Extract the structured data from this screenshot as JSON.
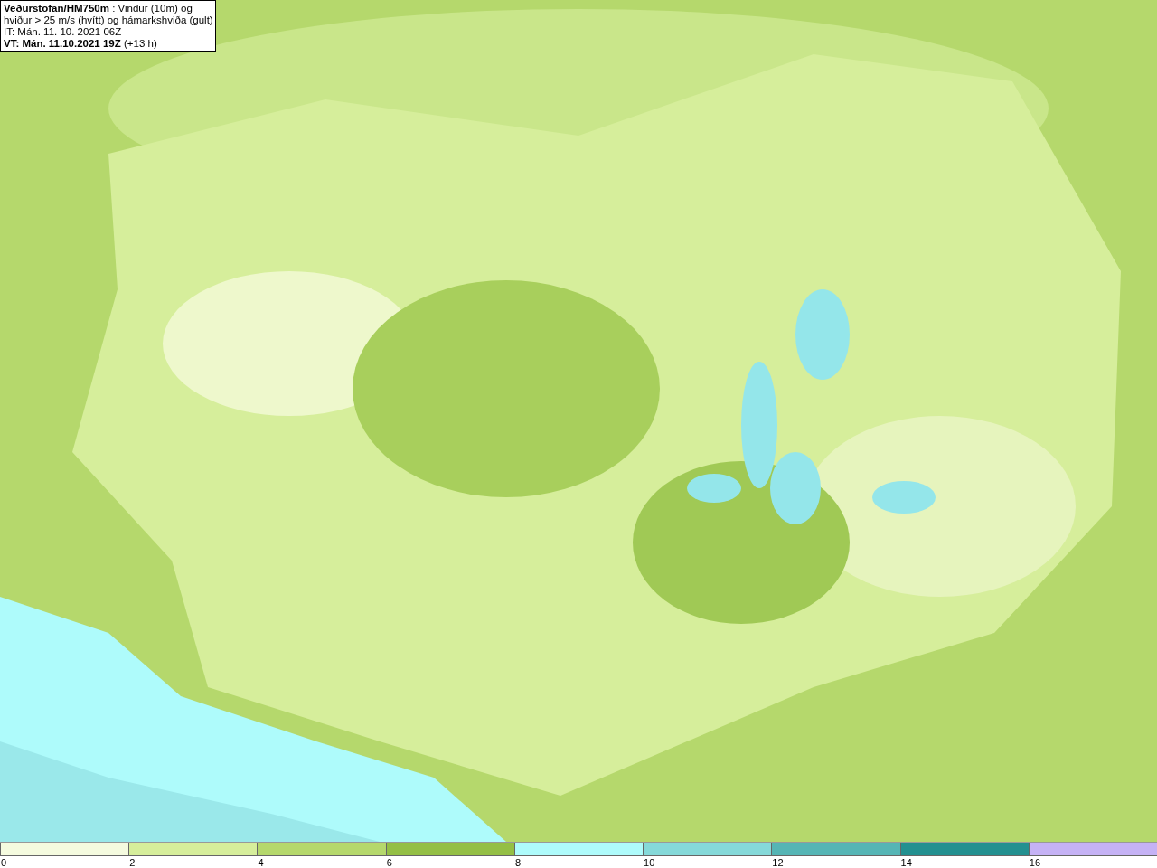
{
  "map": {
    "caption": {
      "heading": "**Veðurstofan/HM750m** : Vindur (10m) og hviður > 25 m/s (hvítt) og hámarkshviða (gult)",
      "issued": "IT: Mán. 11. 10. 2021 06Z",
      "valid": "**VT: Mán. 11.10.2021 19Z** (+13 h)"
    }
  },
  "legend": [
    {
      "color": "#f5fbdf",
      "label": "0"
    },
    {
      "color": "#d6ee9b",
      "label": "2"
    },
    {
      "color": "#b5d86c",
      "label": "4"
    },
    {
      "color": "#94bf45",
      "label": "6"
    },
    {
      "color": "#aefbfb",
      "label": "8"
    },
    {
      "color": "#85d9d9",
      "label": "10"
    },
    {
      "color": "#55b5b5",
      "label": "12"
    },
    {
      "color": "#239090",
      "label": "14"
    },
    {
      "color": "#c5b2f5",
      "label": "16"
    }
  ]
}
